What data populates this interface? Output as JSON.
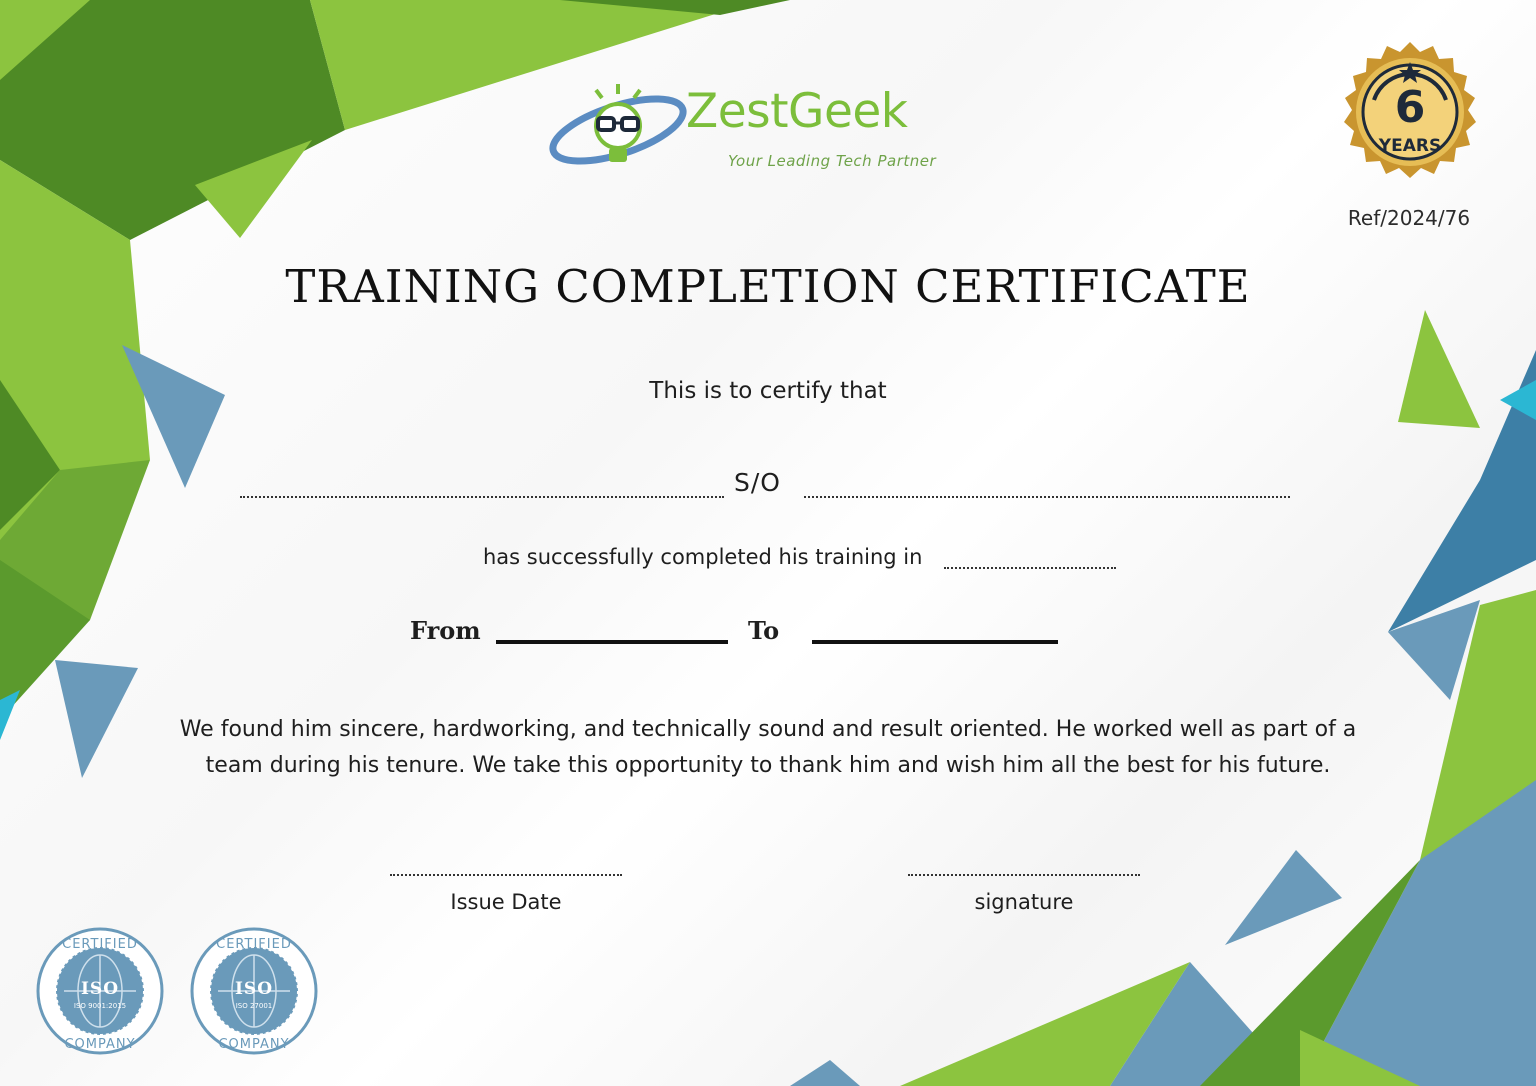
{
  "logo": {
    "name": "ZestGeek",
    "tagline": "Your Leading Tech Partner",
    "icon": "lightbulb-glasses-icon"
  },
  "badge": {
    "number": "6",
    "label": "YEARS",
    "colors": {
      "gold": "#c9952f",
      "navy": "#1e2a3a"
    }
  },
  "reference": "Ref/2024/76",
  "certificate": {
    "title": "TRAINING COMPLETION CERTIFICATE",
    "intro": "This is to certify that",
    "relation": "S/O",
    "completed_text": "has successfully completed his training in",
    "from_label": "From",
    "to_label": "To",
    "body": "We found him sincere, hardworking, and technically sound and result oriented. He worked well as part of a team during his tenure. We take this opportunity to thank him and wish him all the best for his future.",
    "issue_date_label": "Issue Date",
    "signature_label": "signature"
  },
  "seals": [
    {
      "top_text": "CERTIFIED",
      "bottom_text": "COMPANY",
      "core": "ISO",
      "standard": "ISO 9001:2015"
    },
    {
      "top_text": "CERTIFIED",
      "bottom_text": "COMPANY",
      "core": "ISO",
      "standard": "ISO 27001"
    }
  ],
  "colors": {
    "green": "#7cbe3b",
    "dark_green": "#4e8a25",
    "blue": "#6a9aba",
    "dark_blue": "#3d7fa6"
  }
}
